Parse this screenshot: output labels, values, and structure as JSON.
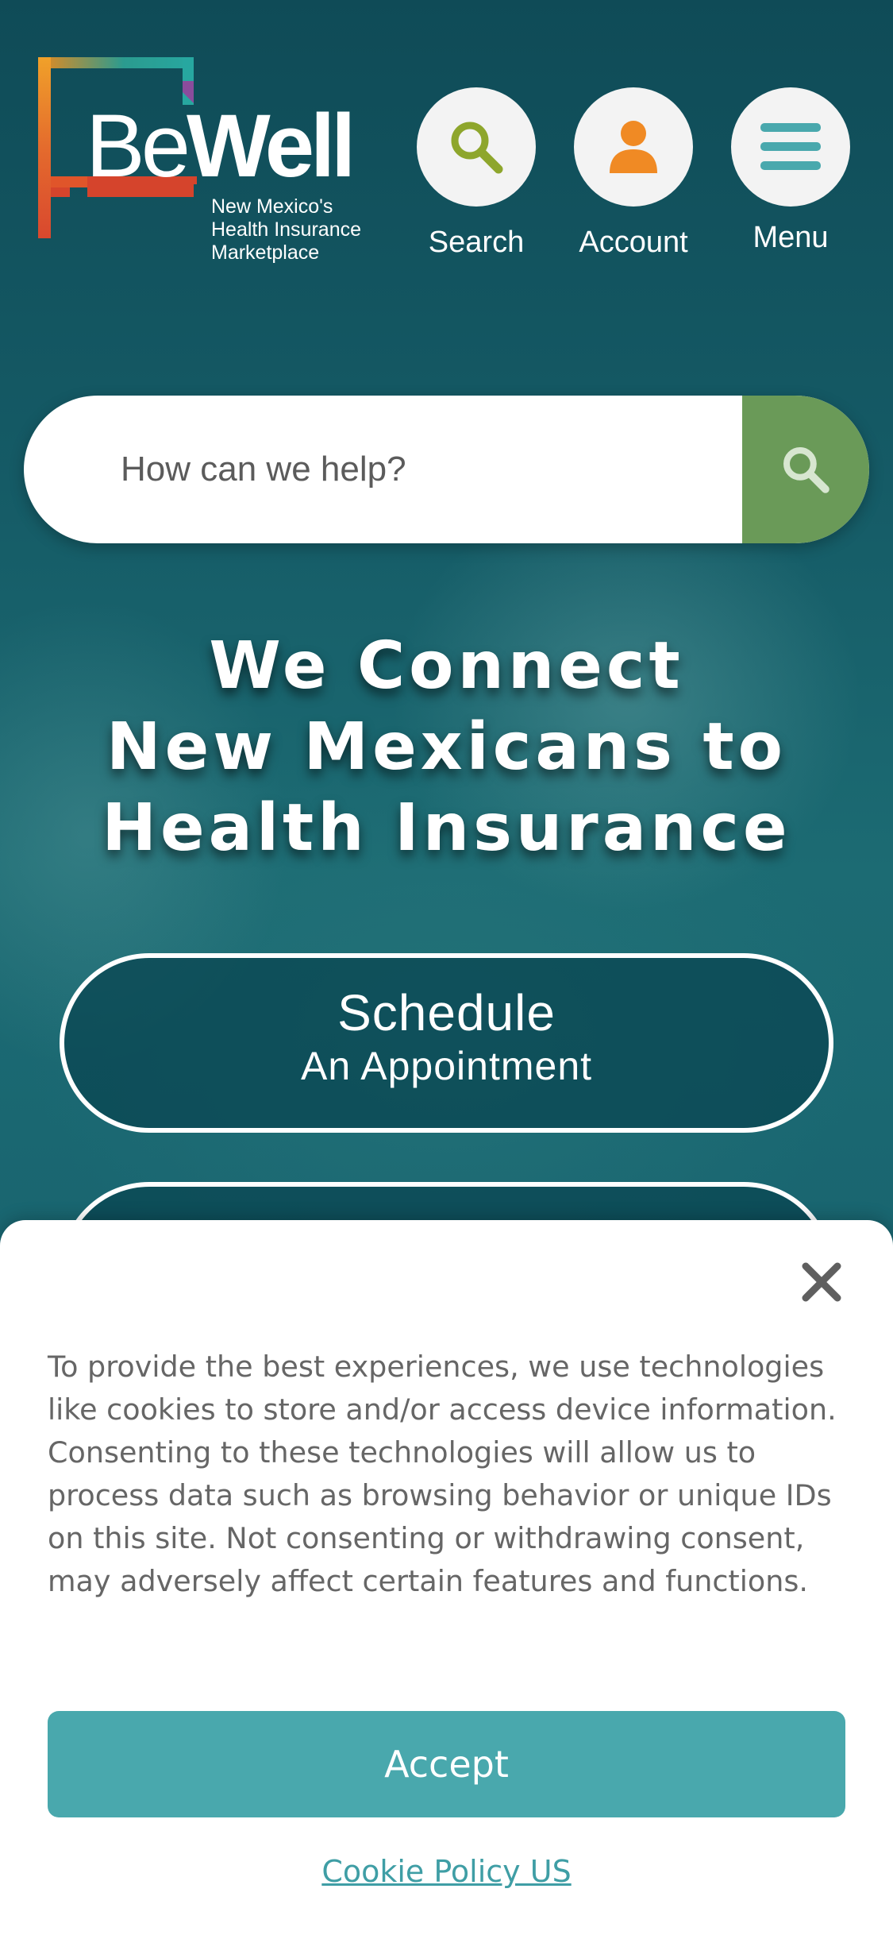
{
  "header": {
    "logo": {
      "word_light": "Be",
      "word_bold": "Well",
      "tagline": [
        "New Mexico's",
        "Health Insurance",
        "Marketplace"
      ]
    },
    "nav": {
      "search_label": "Search",
      "account_label": "Account",
      "menu_label": "Menu"
    },
    "icons": {
      "search": "search-icon",
      "account": "user-icon",
      "menu": "hamburger-icon"
    }
  },
  "search": {
    "placeholder": "How can we help?",
    "submit_icon": "search-icon"
  },
  "hero": {
    "title_lines": [
      "We Connect",
      "New Mexicans to",
      "Health Insurance"
    ],
    "cta_primary": {
      "main": "Schedule",
      "sub": "An Appointment"
    }
  },
  "cookie_banner": {
    "text": "To provide the best experiences, we use technologies like cookies to store and/or access device information. Consenting to these technologies will allow us to process data such as browsing behavior or unique IDs on this site. Not consenting or withdrawing consent, may adversely affect certain features and functions.",
    "accept_label": "Accept",
    "policy_link": "Cookie Policy US",
    "close_icon": "close-icon"
  },
  "colors": {
    "brand_teal": "#49a8ad",
    "search_green": "#6a9a58",
    "account_orange": "#f08a24",
    "search_icon_green": "#8ea62c",
    "hero_bg": "#155b66"
  }
}
